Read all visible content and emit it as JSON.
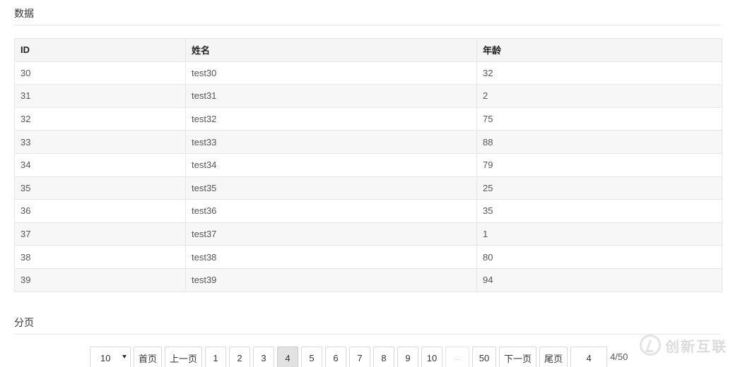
{
  "sections": {
    "data_title": "数据",
    "pagination_title": "分页"
  },
  "table": {
    "headers": [
      "ID",
      "姓名",
      "年龄"
    ],
    "rows": [
      [
        "30",
        "test30",
        "32"
      ],
      [
        "31",
        "test31",
        "2"
      ],
      [
        "32",
        "test32",
        "75"
      ],
      [
        "33",
        "test33",
        "88"
      ],
      [
        "34",
        "test34",
        "79"
      ],
      [
        "35",
        "test35",
        "25"
      ],
      [
        "36",
        "test36",
        "35"
      ],
      [
        "37",
        "test37",
        "1"
      ],
      [
        "38",
        "test38",
        "80"
      ],
      [
        "39",
        "test39",
        "94"
      ]
    ]
  },
  "pagination": {
    "page_size": "10",
    "first_label": "首页",
    "prev_label": "上一页",
    "pages": [
      "1",
      "2",
      "3",
      "4",
      "5",
      "6",
      "7",
      "8",
      "9",
      "10"
    ],
    "current_page": "4",
    "ellipsis": "...",
    "last_page_num": "50",
    "next_label": "下一页",
    "last_label": "尾页",
    "jump_value": "4",
    "page_count": "4/50"
  },
  "watermark": {
    "text": "创新互联",
    "icon": "brand-logo-icon"
  }
}
